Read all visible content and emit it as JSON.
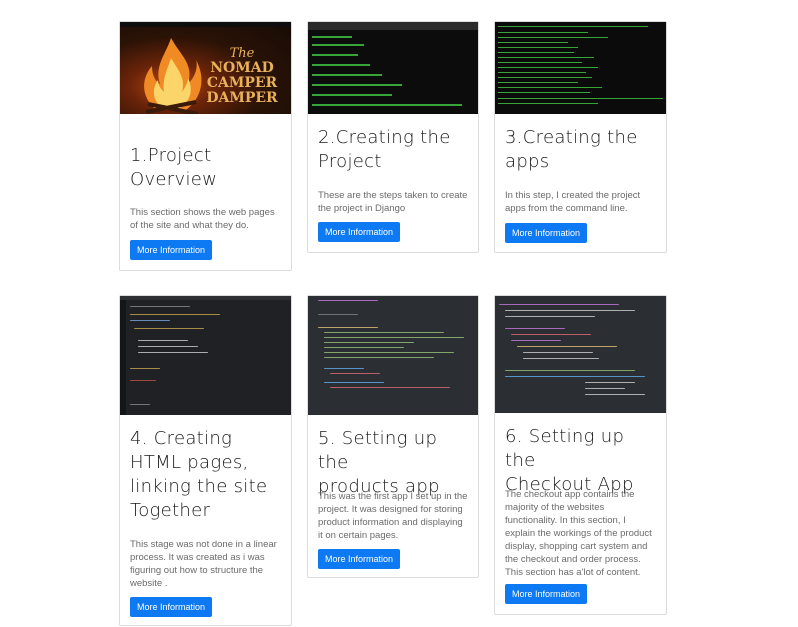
{
  "cards": [
    {
      "title_lines": [
        "1.Project",
        "Overview"
      ],
      "text_lines": [
        "This section shows the web pages",
        "of the site and what they do."
      ],
      "button": "More Information",
      "thumb_label": "The NOMAD CAMPER DAMPER"
    },
    {
      "title_lines": [
        "2.Creating the",
        "Project"
      ],
      "text_lines": [
        "These are the steps taken to create",
        "the project in Django"
      ],
      "button": "More Information"
    },
    {
      "title_lines": [
        "3.Creating the",
        "apps"
      ],
      "text_lines": [
        "In this step, I created the project",
        "apps from the command line."
      ],
      "button": "More Information"
    },
    {
      "title_lines": [
        "4. Creating",
        "HTML pages,",
        "linking the site",
        "Together"
      ],
      "text_lines": [
        "This stage was not done in a linear",
        "process. It was created as i was",
        "figuring out how to structure the",
        "website ."
      ],
      "button": "More Information"
    },
    {
      "title_lines": [
        "5. Setting up the",
        "products app"
      ],
      "text_lines": [
        "This was the first app I set up in the",
        "project. It was designed for storing",
        "product information and displaying",
        "it on certain pages."
      ],
      "button": "More Information"
    },
    {
      "title_lines": [
        "6. Setting up the",
        "Checkout App"
      ],
      "text_lines": [
        "The checkout app contains the",
        "majority of the websites",
        "functionality. In this section, I",
        "explain the workings of the product",
        "display, shopping cart system and",
        "the checkout and order process.",
        "This section has a'lot of content."
      ],
      "button": "More Information"
    }
  ],
  "colors": {
    "button": "#0d79f2",
    "terminal_text": "#3fbf3f",
    "code_bg": "#2b2e33"
  }
}
